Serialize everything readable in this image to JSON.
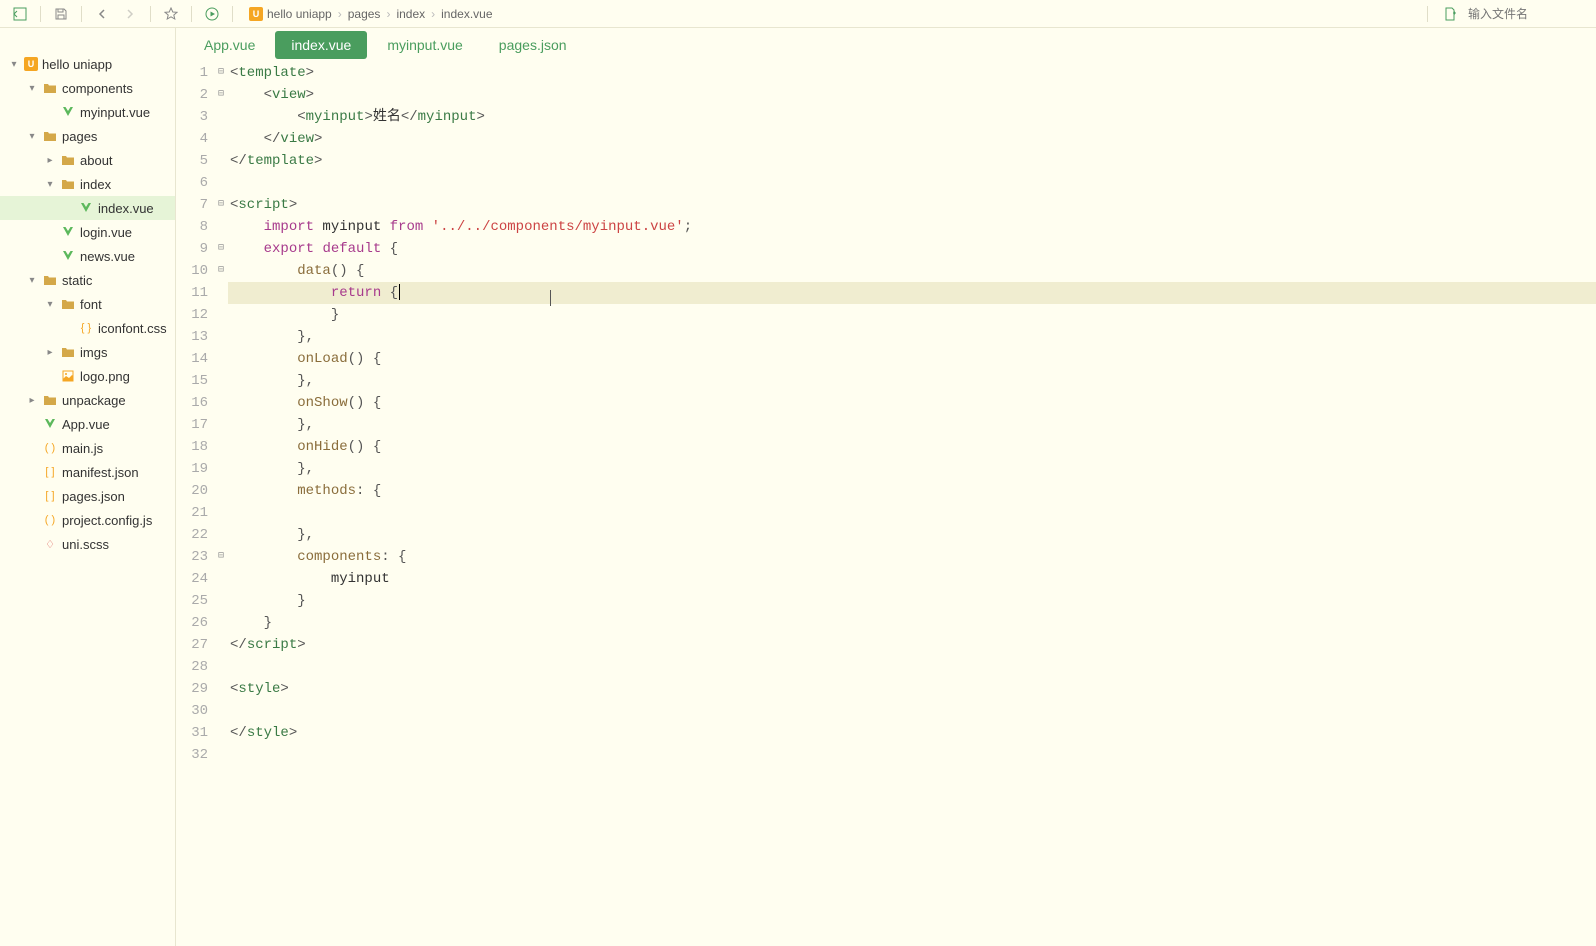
{
  "toolbar": {
    "breadcrumb": [
      {
        "label": "hello uniapp",
        "icon": "project"
      },
      {
        "label": "pages"
      },
      {
        "label": "index"
      },
      {
        "label": "index.vue"
      }
    ],
    "search_placeholder": "输入文件名"
  },
  "sidebar": {
    "tree": [
      {
        "depth": 0,
        "chevron": "down",
        "icon": "project",
        "label": "hello uniapp"
      },
      {
        "depth": 1,
        "chevron": "down",
        "icon": "folder",
        "label": "components"
      },
      {
        "depth": 2,
        "chevron": "blank",
        "icon": "vue",
        "label": "myinput.vue"
      },
      {
        "depth": 1,
        "chevron": "down",
        "icon": "folder",
        "label": "pages"
      },
      {
        "depth": 2,
        "chevron": "right",
        "icon": "folder",
        "label": "about"
      },
      {
        "depth": 2,
        "chevron": "down",
        "icon": "folder",
        "label": "index"
      },
      {
        "depth": 3,
        "chevron": "blank",
        "icon": "vue",
        "label": "index.vue",
        "selected": true
      },
      {
        "depth": 2,
        "chevron": "blank",
        "icon": "vue",
        "label": "login.vue"
      },
      {
        "depth": 2,
        "chevron": "blank",
        "icon": "vue",
        "label": "news.vue"
      },
      {
        "depth": 1,
        "chevron": "down",
        "icon": "folder",
        "label": "static"
      },
      {
        "depth": 2,
        "chevron": "down",
        "icon": "folder",
        "label": "font"
      },
      {
        "depth": 3,
        "chevron": "blank",
        "icon": "css",
        "label": "iconfont.css"
      },
      {
        "depth": 2,
        "chevron": "right",
        "icon": "folder",
        "label": "imgs"
      },
      {
        "depth": 2,
        "chevron": "blank",
        "icon": "img",
        "label": "logo.png"
      },
      {
        "depth": 1,
        "chevron": "right",
        "icon": "folder",
        "label": "unpackage"
      },
      {
        "depth": 1,
        "chevron": "blank",
        "icon": "vue",
        "label": "App.vue"
      },
      {
        "depth": 1,
        "chevron": "blank",
        "icon": "js",
        "label": "main.js"
      },
      {
        "depth": 1,
        "chevron": "blank",
        "icon": "json",
        "label": "manifest.json"
      },
      {
        "depth": 1,
        "chevron": "blank",
        "icon": "json",
        "label": "pages.json"
      },
      {
        "depth": 1,
        "chevron": "blank",
        "icon": "js",
        "label": "project.config.js"
      },
      {
        "depth": 1,
        "chevron": "blank",
        "icon": "scss",
        "label": "uni.scss"
      }
    ]
  },
  "tabs": [
    {
      "label": "App.vue",
      "active": false
    },
    {
      "label": "index.vue",
      "active": true
    },
    {
      "label": "myinput.vue",
      "active": false
    },
    {
      "label": "pages.json",
      "active": false
    }
  ],
  "code": {
    "highlighted_line": 11,
    "lines": [
      {
        "n": 1,
        "fold": "open",
        "tokens": [
          {
            "c": "s-punc",
            "t": "<"
          },
          {
            "c": "s-tag",
            "t": "template"
          },
          {
            "c": "s-punc",
            "t": ">"
          }
        ]
      },
      {
        "n": 2,
        "fold": "open",
        "tokens": [
          {
            "c": "s-plain",
            "t": "    "
          },
          {
            "c": "s-punc",
            "t": "<"
          },
          {
            "c": "s-tag",
            "t": "view"
          },
          {
            "c": "s-punc",
            "t": ">"
          }
        ]
      },
      {
        "n": 3,
        "fold": "",
        "tokens": [
          {
            "c": "s-plain",
            "t": "        "
          },
          {
            "c": "s-punc",
            "t": "<"
          },
          {
            "c": "s-tag",
            "t": "myinput"
          },
          {
            "c": "s-punc",
            "t": ">"
          },
          {
            "c": "s-plain",
            "t": "姓名"
          },
          {
            "c": "s-punc",
            "t": "</"
          },
          {
            "c": "s-tag",
            "t": "myinput"
          },
          {
            "c": "s-punc",
            "t": ">"
          }
        ]
      },
      {
        "n": 4,
        "fold": "",
        "tokens": [
          {
            "c": "s-plain",
            "t": "    "
          },
          {
            "c": "s-punc",
            "t": "</"
          },
          {
            "c": "s-tag",
            "t": "view"
          },
          {
            "c": "s-punc",
            "t": ">"
          }
        ]
      },
      {
        "n": 5,
        "fold": "",
        "tokens": [
          {
            "c": "s-punc",
            "t": "</"
          },
          {
            "c": "s-tag",
            "t": "template"
          },
          {
            "c": "s-punc",
            "t": ">"
          }
        ]
      },
      {
        "n": 6,
        "fold": "",
        "tokens": []
      },
      {
        "n": 7,
        "fold": "open",
        "tokens": [
          {
            "c": "s-punc",
            "t": "<"
          },
          {
            "c": "s-tag",
            "t": "script"
          },
          {
            "c": "s-punc",
            "t": ">"
          }
        ]
      },
      {
        "n": 8,
        "fold": "",
        "tokens": [
          {
            "c": "s-plain",
            "t": "    "
          },
          {
            "c": "s-key",
            "t": "import"
          },
          {
            "c": "s-plain",
            "t": " myinput "
          },
          {
            "c": "s-key",
            "t": "from"
          },
          {
            "c": "s-plain",
            "t": " "
          },
          {
            "c": "s-str",
            "t": "'../../components/myinput.vue'"
          },
          {
            "c": "s-punc",
            "t": ";"
          }
        ]
      },
      {
        "n": 9,
        "fold": "open",
        "tokens": [
          {
            "c": "s-plain",
            "t": "    "
          },
          {
            "c": "s-key",
            "t": "export"
          },
          {
            "c": "s-plain",
            "t": " "
          },
          {
            "c": "s-key",
            "t": "default"
          },
          {
            "c": "s-plain",
            "t": " "
          },
          {
            "c": "s-punc",
            "t": "{"
          }
        ]
      },
      {
        "n": 10,
        "fold": "open",
        "tokens": [
          {
            "c": "s-plain",
            "t": "        "
          },
          {
            "c": "s-method",
            "t": "data"
          },
          {
            "c": "s-punc",
            "t": "() {"
          }
        ]
      },
      {
        "n": 11,
        "fold": "",
        "tokens": [
          {
            "c": "s-plain",
            "t": "            "
          },
          {
            "c": "s-key",
            "t": "return"
          },
          {
            "c": "s-plain",
            "t": " "
          },
          {
            "c": "s-punc",
            "t": "{"
          }
        ]
      },
      {
        "n": 12,
        "fold": "",
        "tokens": [
          {
            "c": "s-plain",
            "t": "            "
          },
          {
            "c": "s-punc",
            "t": "}"
          }
        ]
      },
      {
        "n": 13,
        "fold": "",
        "tokens": [
          {
            "c": "s-plain",
            "t": "        "
          },
          {
            "c": "s-punc",
            "t": "},"
          }
        ]
      },
      {
        "n": 14,
        "fold": "",
        "tokens": [
          {
            "c": "s-plain",
            "t": "        "
          },
          {
            "c": "s-method",
            "t": "onLoad"
          },
          {
            "c": "s-punc",
            "t": "() {"
          }
        ]
      },
      {
        "n": 15,
        "fold": "",
        "tokens": [
          {
            "c": "s-plain",
            "t": "        "
          },
          {
            "c": "s-punc",
            "t": "},"
          }
        ]
      },
      {
        "n": 16,
        "fold": "",
        "tokens": [
          {
            "c": "s-plain",
            "t": "        "
          },
          {
            "c": "s-method",
            "t": "onShow"
          },
          {
            "c": "s-punc",
            "t": "() {"
          }
        ]
      },
      {
        "n": 17,
        "fold": "",
        "tokens": [
          {
            "c": "s-plain",
            "t": "        "
          },
          {
            "c": "s-punc",
            "t": "},"
          }
        ]
      },
      {
        "n": 18,
        "fold": "",
        "tokens": [
          {
            "c": "s-plain",
            "t": "        "
          },
          {
            "c": "s-method",
            "t": "onHide"
          },
          {
            "c": "s-punc",
            "t": "() {"
          }
        ]
      },
      {
        "n": 19,
        "fold": "",
        "tokens": [
          {
            "c": "s-plain",
            "t": "        "
          },
          {
            "c": "s-punc",
            "t": "},"
          }
        ]
      },
      {
        "n": 20,
        "fold": "",
        "tokens": [
          {
            "c": "s-plain",
            "t": "        "
          },
          {
            "c": "s-method",
            "t": "methods"
          },
          {
            "c": "s-punc",
            "t": ": {"
          }
        ]
      },
      {
        "n": 21,
        "fold": "",
        "tokens": []
      },
      {
        "n": 22,
        "fold": "",
        "tokens": [
          {
            "c": "s-plain",
            "t": "        "
          },
          {
            "c": "s-punc",
            "t": "},"
          }
        ]
      },
      {
        "n": 23,
        "fold": "open",
        "tokens": [
          {
            "c": "s-plain",
            "t": "        "
          },
          {
            "c": "s-method",
            "t": "components"
          },
          {
            "c": "s-punc",
            "t": ": {"
          }
        ]
      },
      {
        "n": 24,
        "fold": "",
        "tokens": [
          {
            "c": "s-plain",
            "t": "            myinput"
          }
        ]
      },
      {
        "n": 25,
        "fold": "",
        "tokens": [
          {
            "c": "s-plain",
            "t": "        "
          },
          {
            "c": "s-punc",
            "t": "}"
          }
        ]
      },
      {
        "n": 26,
        "fold": "",
        "tokens": [
          {
            "c": "s-plain",
            "t": "    "
          },
          {
            "c": "s-punc",
            "t": "}"
          }
        ]
      },
      {
        "n": 27,
        "fold": "",
        "tokens": [
          {
            "c": "s-punc",
            "t": "</"
          },
          {
            "c": "s-tag",
            "t": "script"
          },
          {
            "c": "s-punc",
            "t": ">"
          }
        ]
      },
      {
        "n": 28,
        "fold": "",
        "tokens": []
      },
      {
        "n": 29,
        "fold": "",
        "tokens": [
          {
            "c": "s-punc",
            "t": "<"
          },
          {
            "c": "s-tag",
            "t": "style"
          },
          {
            "c": "s-punc",
            "t": ">"
          }
        ]
      },
      {
        "n": 30,
        "fold": "",
        "tokens": []
      },
      {
        "n": 31,
        "fold": "",
        "tokens": [
          {
            "c": "s-punc",
            "t": "</"
          },
          {
            "c": "s-tag",
            "t": "style"
          },
          {
            "c": "s-punc",
            "t": ">"
          }
        ]
      },
      {
        "n": 32,
        "fold": "",
        "tokens": []
      }
    ]
  }
}
